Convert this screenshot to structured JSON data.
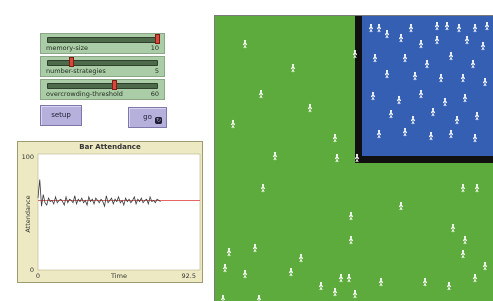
{
  "sliders": [
    {
      "label": "memory-size",
      "value": "10",
      "fraction": 1.0
    },
    {
      "label": "number-strategies",
      "value": "5",
      "fraction": 0.2
    },
    {
      "label": "overcrowding-threshold",
      "value": "60",
      "fraction": 0.6
    }
  ],
  "buttons": {
    "setup_label": "setup",
    "go_label": "go"
  },
  "chart_data": {
    "type": "line",
    "title": "Bar Attendance",
    "xlabel": "Time",
    "ylabel": "Attendance",
    "xlim": [
      0,
      92.5
    ],
    "ylim": [
      0,
      100
    ],
    "x_tick_labels": [
      "0",
      "92.5"
    ],
    "y_tick_labels": [
      "0",
      "100"
    ],
    "series": [
      {
        "color": "#3a3a3a",
        "x": [
          0,
          1,
          2,
          3,
          4,
          5,
          6,
          7,
          8,
          9,
          10,
          11,
          12,
          13,
          14,
          15,
          16,
          17,
          18,
          19,
          20,
          21,
          22,
          23,
          24,
          25,
          26,
          27,
          28,
          29,
          30,
          31,
          32,
          33,
          34,
          35,
          36,
          37,
          38,
          39,
          40,
          41,
          42,
          43,
          44,
          45,
          46,
          47,
          48,
          49,
          50,
          51,
          52,
          53,
          54,
          55,
          56,
          57,
          58,
          59,
          60,
          61,
          62,
          63,
          64,
          65,
          66,
          67,
          68,
          69,
          70
        ],
        "values": [
          62,
          78,
          55,
          65,
          58,
          56,
          62,
          59,
          60,
          57,
          63,
          58,
          60,
          61,
          59,
          56,
          63,
          58,
          61,
          60,
          58,
          64,
          57,
          61,
          59,
          62,
          58,
          60,
          56,
          63,
          59,
          61,
          57,
          62,
          60,
          58,
          61,
          59,
          55,
          64,
          58,
          60,
          62,
          57,
          61,
          59,
          63,
          58,
          60,
          56,
          62,
          59,
          61,
          58,
          60,
          63,
          57,
          61,
          59,
          62,
          58,
          60,
          61,
          57,
          63,
          59,
          60,
          58,
          61,
          60,
          59
        ]
      },
      {
        "color": "#e05050",
        "x": [
          0,
          92.5
        ],
        "values": [
          60,
          60
        ]
      }
    ]
  },
  "world": {
    "background_color": "#5cab3c",
    "bar_color": "#345fb2",
    "agent_icon": "person-icon"
  }
}
